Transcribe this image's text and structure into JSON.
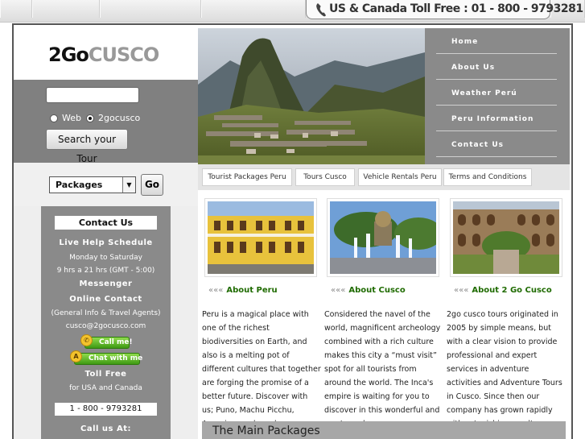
{
  "topbar": {
    "toll_text": "US & Canada Toll Free : 01 - 800 - 9793281"
  },
  "logo": {
    "part1": "2Go",
    "part2": "CUSCO"
  },
  "search": {
    "input_value": "",
    "radio_web": "Web",
    "radio_site": "2gocusco",
    "selected_radio": "2gocusco",
    "button": "Search your Tour"
  },
  "packages": {
    "select_value": "Packages",
    "go_button": "Go"
  },
  "contact": {
    "title": "Contact Us",
    "live_help": "Live Help Schedule",
    "days": "Monday to Saturday",
    "hours": "9 hrs a 21 hrs (GMT - 5:00)",
    "messenger": "Messenger",
    "online_contact": "Online Contact",
    "general_info": "(General Info & Travel Agents)",
    "email": "cusco@2gocusco.com",
    "call_me": "Call me!",
    "chat_with_me": "Chat with me",
    "toll_free": "Toll Free",
    "for_us_canada": "for USA and Canada",
    "toll_number": "1 - 800 - 9793281",
    "call_us_at": "Call us At:"
  },
  "nav": {
    "items": [
      {
        "label": "Home"
      },
      {
        "label": "About Us"
      },
      {
        "label": "Weather Perú"
      },
      {
        "label": "Peru Information"
      },
      {
        "label": "Contact Us"
      }
    ]
  },
  "tabs": [
    {
      "label": "Tourist Packages Peru"
    },
    {
      "label": "Tours Cusco"
    },
    {
      "label": "Vehicle Rentals Peru"
    },
    {
      "label": "Terms and Conditions"
    }
  ],
  "columns": [
    {
      "quote": "«««",
      "heading": "About Peru",
      "text": "Peru is a magical place with one of the richest biodiversities on Earth, and also is a melting pot of different cultures that together are forging the promise of a better future. Discover with us; Puno, Machu Picchu, Arequipa, and much more…"
    },
    {
      "quote": "«««",
      "heading": "About Cusco",
      "text": "Considered the navel of the world, magnificent archeology combined with a rich culture makes this city a “must visit” spot for all tourists from around the world. The Inca's empire is waiting for you to discover in this wonderful and mystery place."
    },
    {
      "quote": "«««",
      "heading": "About 2 Go Cusco",
      "text": "2go cusco tours originated in 2005 by simple means, but with a clear vision to provide professional and expert services in adventure activities and Adventure Tours in Cusco. Since then our company has grown rapidly with astonishing results."
    }
  ],
  "main_packages": {
    "title": "The Main Packages"
  }
}
